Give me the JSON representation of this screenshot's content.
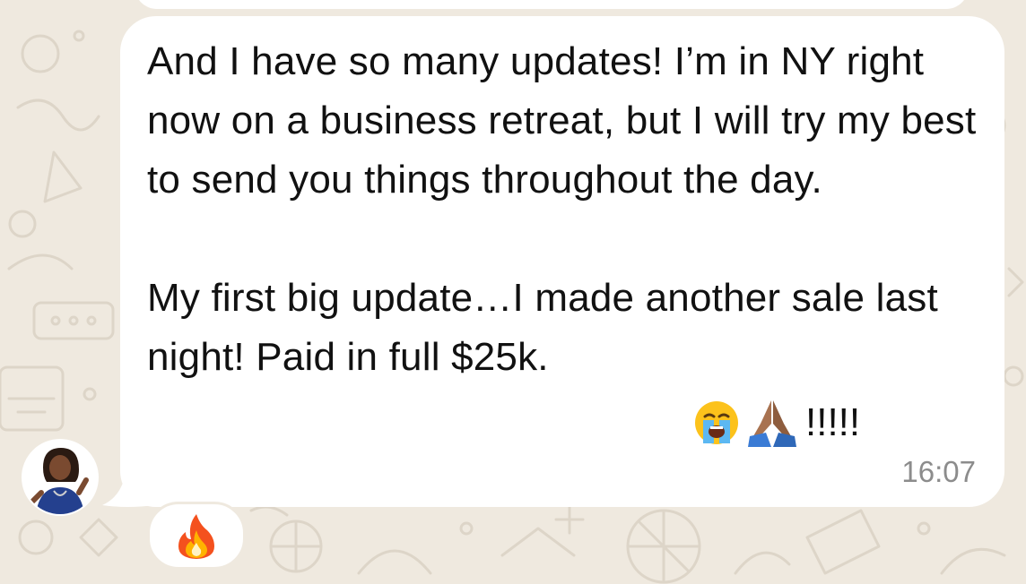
{
  "conversation": {
    "message": {
      "text": "And I have so many updates! I’m in NY right now on a business retreat, but I will try my best to send you things throughout the day.\n\nMy first big update…I made another sale last night! Paid in full $25k.",
      "emoji_suffix": "!!!!!",
      "emojis": [
        "loudly-crying-face-icon",
        "folded-hands-icon"
      ],
      "timestamp": "16:07"
    },
    "reaction": {
      "emoji": "fire-icon"
    },
    "sender": {
      "avatar": "avatar-photo"
    }
  },
  "colors": {
    "wallpaper": "#efe9df",
    "bubble": "#ffffff",
    "text": "#111111",
    "timestamp": "#8c8c8c"
  }
}
